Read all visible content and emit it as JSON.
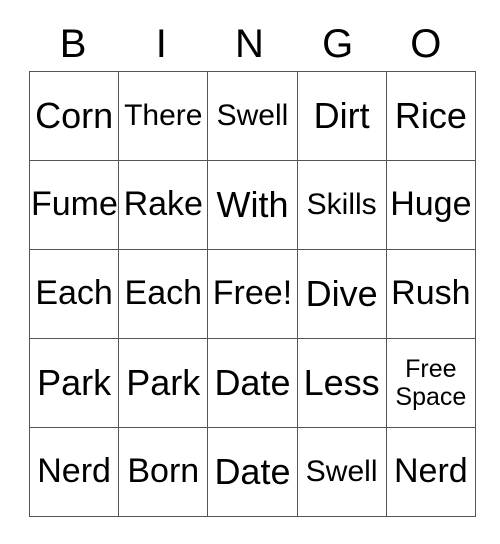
{
  "card": {
    "header_letters": [
      "B",
      "I",
      "N",
      "G",
      "O"
    ],
    "columns": 5,
    "rows": 5,
    "border_color": "#555555",
    "text_color": "#000000",
    "background_color": "#ffffff",
    "cells": [
      [
        {
          "text": "Corn",
          "size": "xl"
        },
        {
          "text": "There",
          "size": "md"
        },
        {
          "text": "Swell",
          "size": "md"
        },
        {
          "text": "Dirt",
          "size": "xl"
        },
        {
          "text": "Rice",
          "size": "xl"
        }
      ],
      [
        {
          "text": "Fume",
          "size": "lg"
        },
        {
          "text": "Rake",
          "size": "lg"
        },
        {
          "text": "With",
          "size": "xl"
        },
        {
          "text": "Skills",
          "size": "md"
        },
        {
          "text": "Huge",
          "size": "lg"
        }
      ],
      [
        {
          "text": "Each",
          "size": "lg"
        },
        {
          "text": "Each",
          "size": "lg"
        },
        {
          "text": "Free!",
          "size": "lg"
        },
        {
          "text": "Dive",
          "size": "xl"
        },
        {
          "text": "Rush",
          "size": "lg"
        }
      ],
      [
        {
          "text": "Park",
          "size": "xl"
        },
        {
          "text": "Park",
          "size": "xl"
        },
        {
          "text": "Date",
          "size": "xl"
        },
        {
          "text": "Less",
          "size": "xl"
        },
        {
          "text": "Free\nSpace",
          "size": "sm"
        }
      ],
      [
        {
          "text": "Nerd",
          "size": "lg"
        },
        {
          "text": "Born",
          "size": "lg"
        },
        {
          "text": "Date",
          "size": "xl"
        },
        {
          "text": "Swell",
          "size": "md"
        },
        {
          "text": "Nerd",
          "size": "lg"
        }
      ]
    ]
  }
}
